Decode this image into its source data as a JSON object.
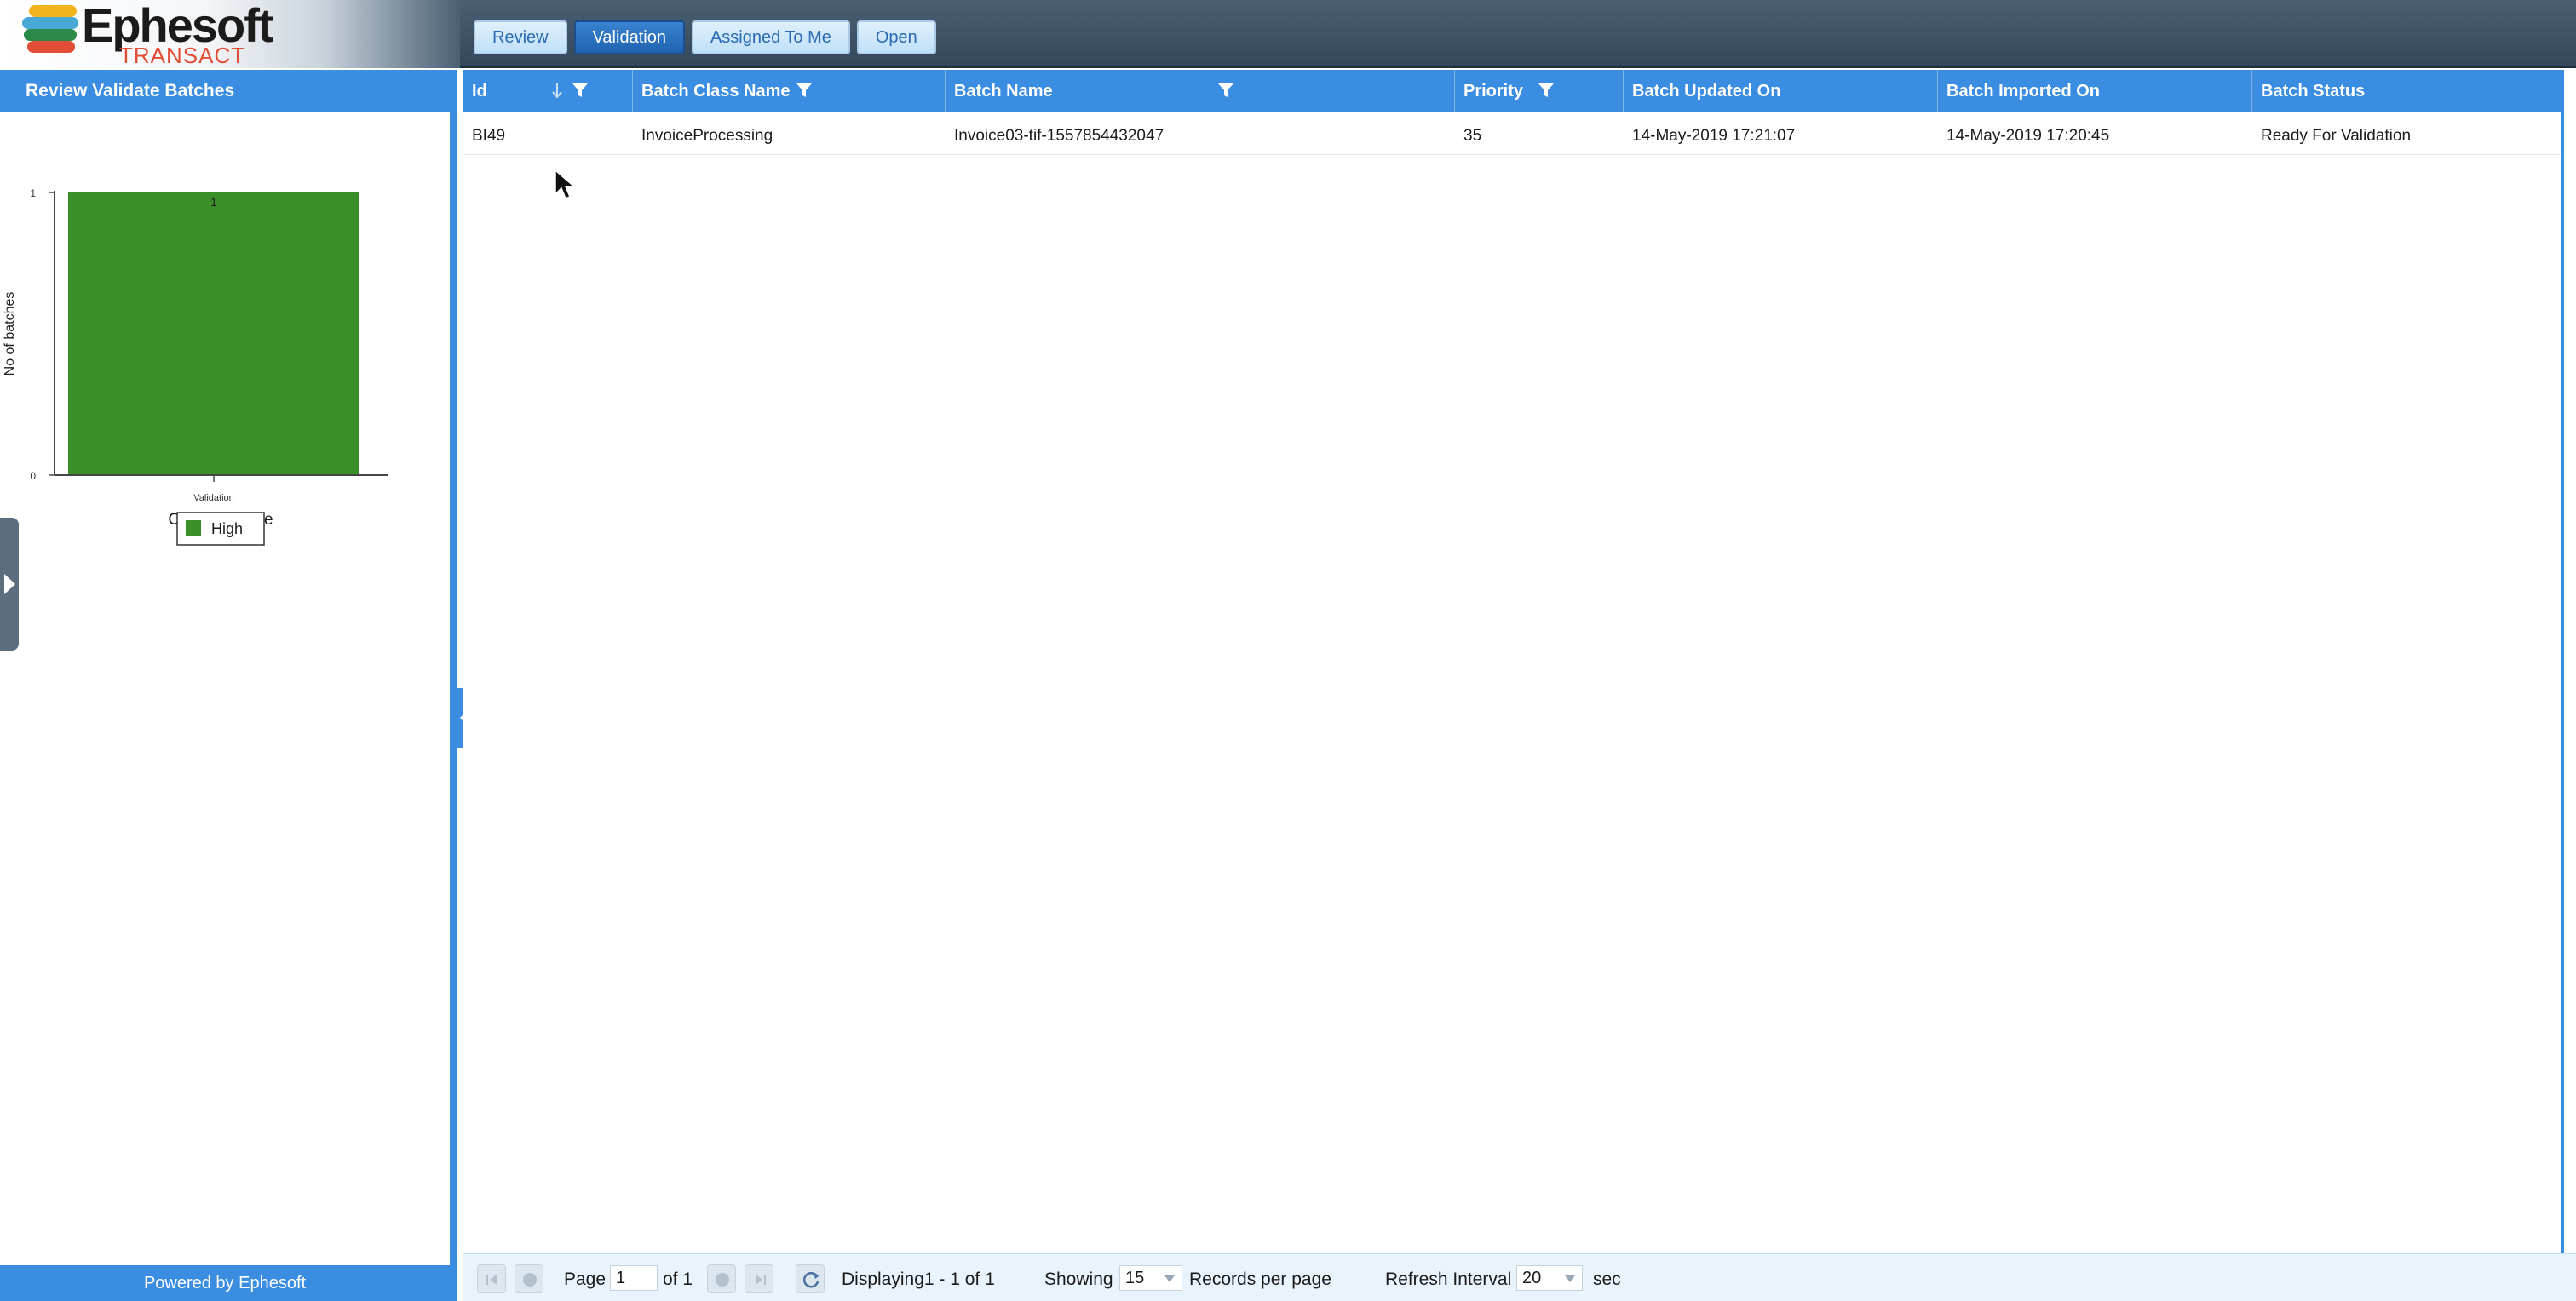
{
  "brand": {
    "name": "Ephesoft",
    "sub": "TRANSACT"
  },
  "top_tabs": [
    {
      "label": "Review",
      "active": false
    },
    {
      "label": "Validation",
      "active": true
    },
    {
      "label": "Assigned To Me",
      "active": false
    },
    {
      "label": "Open",
      "active": false
    }
  ],
  "left_panel": {
    "title": "Review Validate Batches",
    "footer": "Powered by Ephesoft"
  },
  "chart_data": {
    "type": "bar",
    "categories": [
      "Validation"
    ],
    "series": [
      {
        "name": "High",
        "values": [
          1
        ],
        "color": "#3a8f28"
      }
    ],
    "xlabel": "Category Type",
    "ylabel": "No of batches",
    "ylim": [
      0,
      1
    ],
    "yticks": [
      "0",
      "1"
    ],
    "data_labels": [
      "1"
    ],
    "legend": [
      "High"
    ],
    "legend_position": "bottom"
  },
  "grid": {
    "columns": [
      {
        "label": "Id"
      },
      {
        "label": "Batch Class Name"
      },
      {
        "label": "Batch Name"
      },
      {
        "label": "Priority"
      },
      {
        "label": "Batch Updated On"
      },
      {
        "label": "Batch Imported On"
      },
      {
        "label": "Batch Status"
      }
    ],
    "rows": [
      {
        "id": "BI49",
        "batch_class": "InvoiceProcessing",
        "batch_name": "Invoice03-tif-1557854432047",
        "priority": "35",
        "updated_on": "14-May-2019 17:21:07",
        "imported_on": "14-May-2019 17:20:45",
        "status": "Ready For Validation"
      }
    ]
  },
  "pager": {
    "page_label": "Page",
    "page_value": "1",
    "of_label": "of 1",
    "displaying": "Displaying1 - 1 of 1",
    "showing_label": "Showing",
    "page_size": "15",
    "records_label": "Records per page",
    "refresh_label": "Refresh Interval",
    "refresh_value": "20",
    "sec_label": "sec"
  },
  "colors": {
    "accent": "#3a8de0",
    "header_bg": "#3e5367",
    "bar": "#3a8f28"
  }
}
